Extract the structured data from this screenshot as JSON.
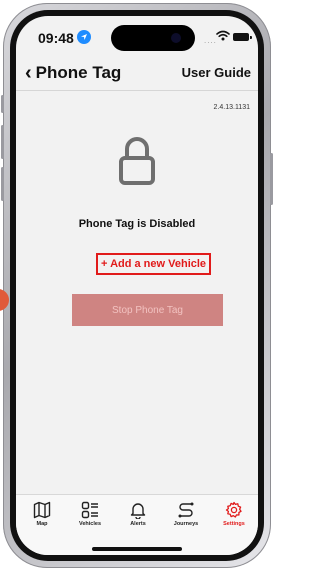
{
  "status_bar": {
    "time": "09:48",
    "signal": "....",
    "location_icon": "location-arrow-icon",
    "wifi_icon": "wifi-icon",
    "battery_icon": "battery-icon"
  },
  "header": {
    "back_icon": "chevron-left-icon",
    "title": "Phone Tag",
    "user_guide": "User Guide"
  },
  "main": {
    "version": "2.4.13.1131",
    "lock_icon": "padlock-icon",
    "status_text": "Phone Tag is Disabled",
    "add_vehicle": "+ Add a new Vehicle",
    "stop_button": "Stop Phone Tag"
  },
  "tabs": [
    {
      "label": "Map",
      "icon": "map-icon",
      "active": false
    },
    {
      "label": "Vehicles",
      "icon": "vehicles-list-icon",
      "active": false
    },
    {
      "label": "Alerts",
      "icon": "bell-icon",
      "active": false
    },
    {
      "label": "Journeys",
      "icon": "route-icon",
      "active": false
    },
    {
      "label": "Settings",
      "icon": "gear-icon",
      "active": true
    }
  ],
  "colors": {
    "accent": "#e11b1b",
    "disabled_button": "#cf8482",
    "screen_background": "#f2f2f2",
    "location_blue": "#1f8cff"
  }
}
